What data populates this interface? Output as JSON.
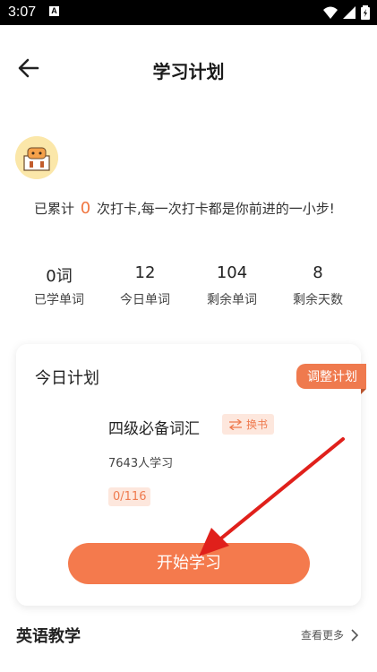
{
  "status_bar": {
    "time": "3:07",
    "app_badge": "A"
  },
  "header": {
    "title": "学习计划"
  },
  "checkin": {
    "prefix": "已累计",
    "count": "0",
    "suffix": "次打卡,每一次打卡都是你前进的一小步!"
  },
  "stats": [
    {
      "value": "0词",
      "label": "已学单词"
    },
    {
      "value": "12",
      "label": "今日单词"
    },
    {
      "value": "104",
      "label": "剩余单词"
    },
    {
      "value": "8",
      "label": "剩余天数"
    }
  ],
  "plan": {
    "title": "今日计划",
    "adjust_label": "调整计划",
    "book_name": "四级必备词汇",
    "swap_label": "换书",
    "learners": "7643人学习",
    "progress": "0/116",
    "start_label": "开始学习"
  },
  "section": {
    "title": "英语教学",
    "more_label": "查看更多"
  },
  "colors": {
    "accent": "#f47a4d",
    "annotation_arrow": "#e0201b"
  }
}
